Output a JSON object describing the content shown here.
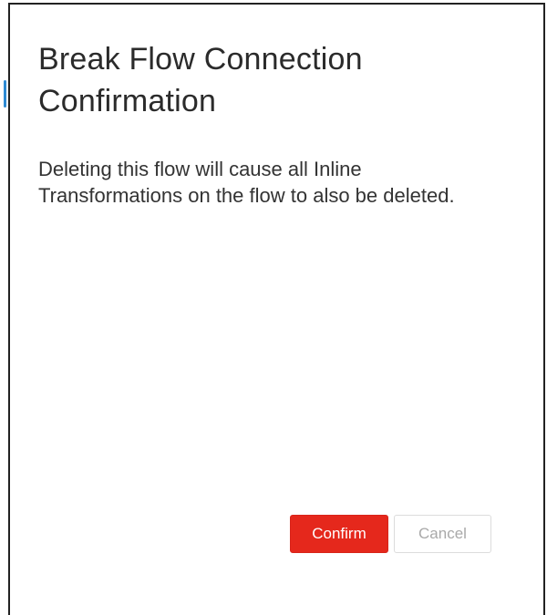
{
  "dialog": {
    "title": "Break Flow Connection Confirmation",
    "message": "Deleting this flow will cause all Inline Transformations on the flow to also be deleted.",
    "confirm_label": "Confirm",
    "cancel_label": "Cancel"
  },
  "colors": {
    "confirm_button_bg": "#e5281c",
    "confirm_button_text": "#ffffff",
    "cancel_button_bg": "#ffffff",
    "cancel_button_text": "#a9a9a9",
    "title_text": "#2b2b2b",
    "body_text": "#333333",
    "dialog_border": "#222222",
    "background_accent": "#2d8ad3"
  }
}
